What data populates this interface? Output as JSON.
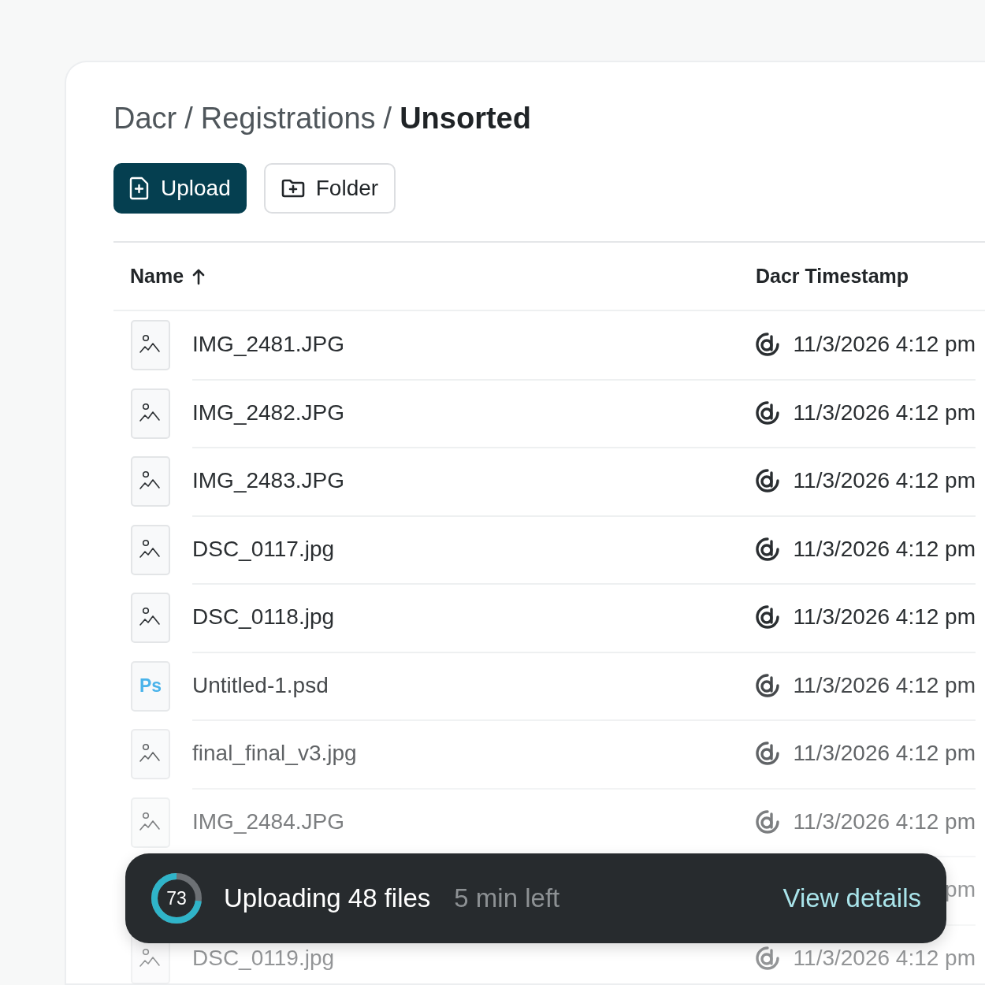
{
  "breadcrumb": [
    {
      "kind": "link",
      "text": "Dacr"
    },
    {
      "kind": "separator",
      "text": "/"
    },
    {
      "kind": "link",
      "text": "Registrations"
    },
    {
      "kind": "separator",
      "text": "/"
    },
    {
      "kind": "current",
      "text": "Unsorted"
    }
  ],
  "actions": [
    {
      "kind": "primary",
      "label": "Upload"
    },
    {
      "kind": "secondary",
      "label": "Folder"
    }
  ],
  "table": {
    "columns": [
      {
        "label": "Name",
        "sorted": true
      },
      {
        "label": "Dacr Timestamp",
        "sorted": false
      }
    ],
    "rows": [
      {
        "kind": "image",
        "name": "IMG_2481.JPG",
        "timestamp": "11/3/2026 4:12 pm"
      },
      {
        "kind": "image",
        "name": "IMG_2482.JPG",
        "timestamp": "11/3/2026 4:12 pm"
      },
      {
        "kind": "image",
        "name": "IMG_2483.JPG",
        "timestamp": "11/3/2026 4:12 pm"
      },
      {
        "kind": "image",
        "name": "DSC_0117.jpg",
        "timestamp": "11/3/2026 4:12 pm"
      },
      {
        "kind": "image",
        "name": "DSC_0118.jpg",
        "timestamp": "11/3/2026 4:12 pm"
      },
      {
        "kind": "psd",
        "badge": "Ps",
        "name": "Untitled-1.psd",
        "timestamp": "11/3/2026 4:12 pm"
      },
      {
        "kind": "image",
        "name": "final_final_v3.jpg",
        "timestamp": "11/3/2026 4:12 pm"
      },
      {
        "kind": "image",
        "name": "IMG_2484.JPG",
        "timestamp": "11/3/2026 4:12 pm"
      },
      {
        "kind": "covered",
        "timestamp": "pm"
      },
      {
        "kind": "image",
        "name": "DSC_0119.jpg",
        "timestamp": "11/3/2026 4:12 pm"
      }
    ]
  },
  "upload_toast": {
    "progress_label": "73",
    "level": 0.73,
    "title": "Uploading 48 files",
    "eta": "5 min left",
    "action": "View details"
  }
}
